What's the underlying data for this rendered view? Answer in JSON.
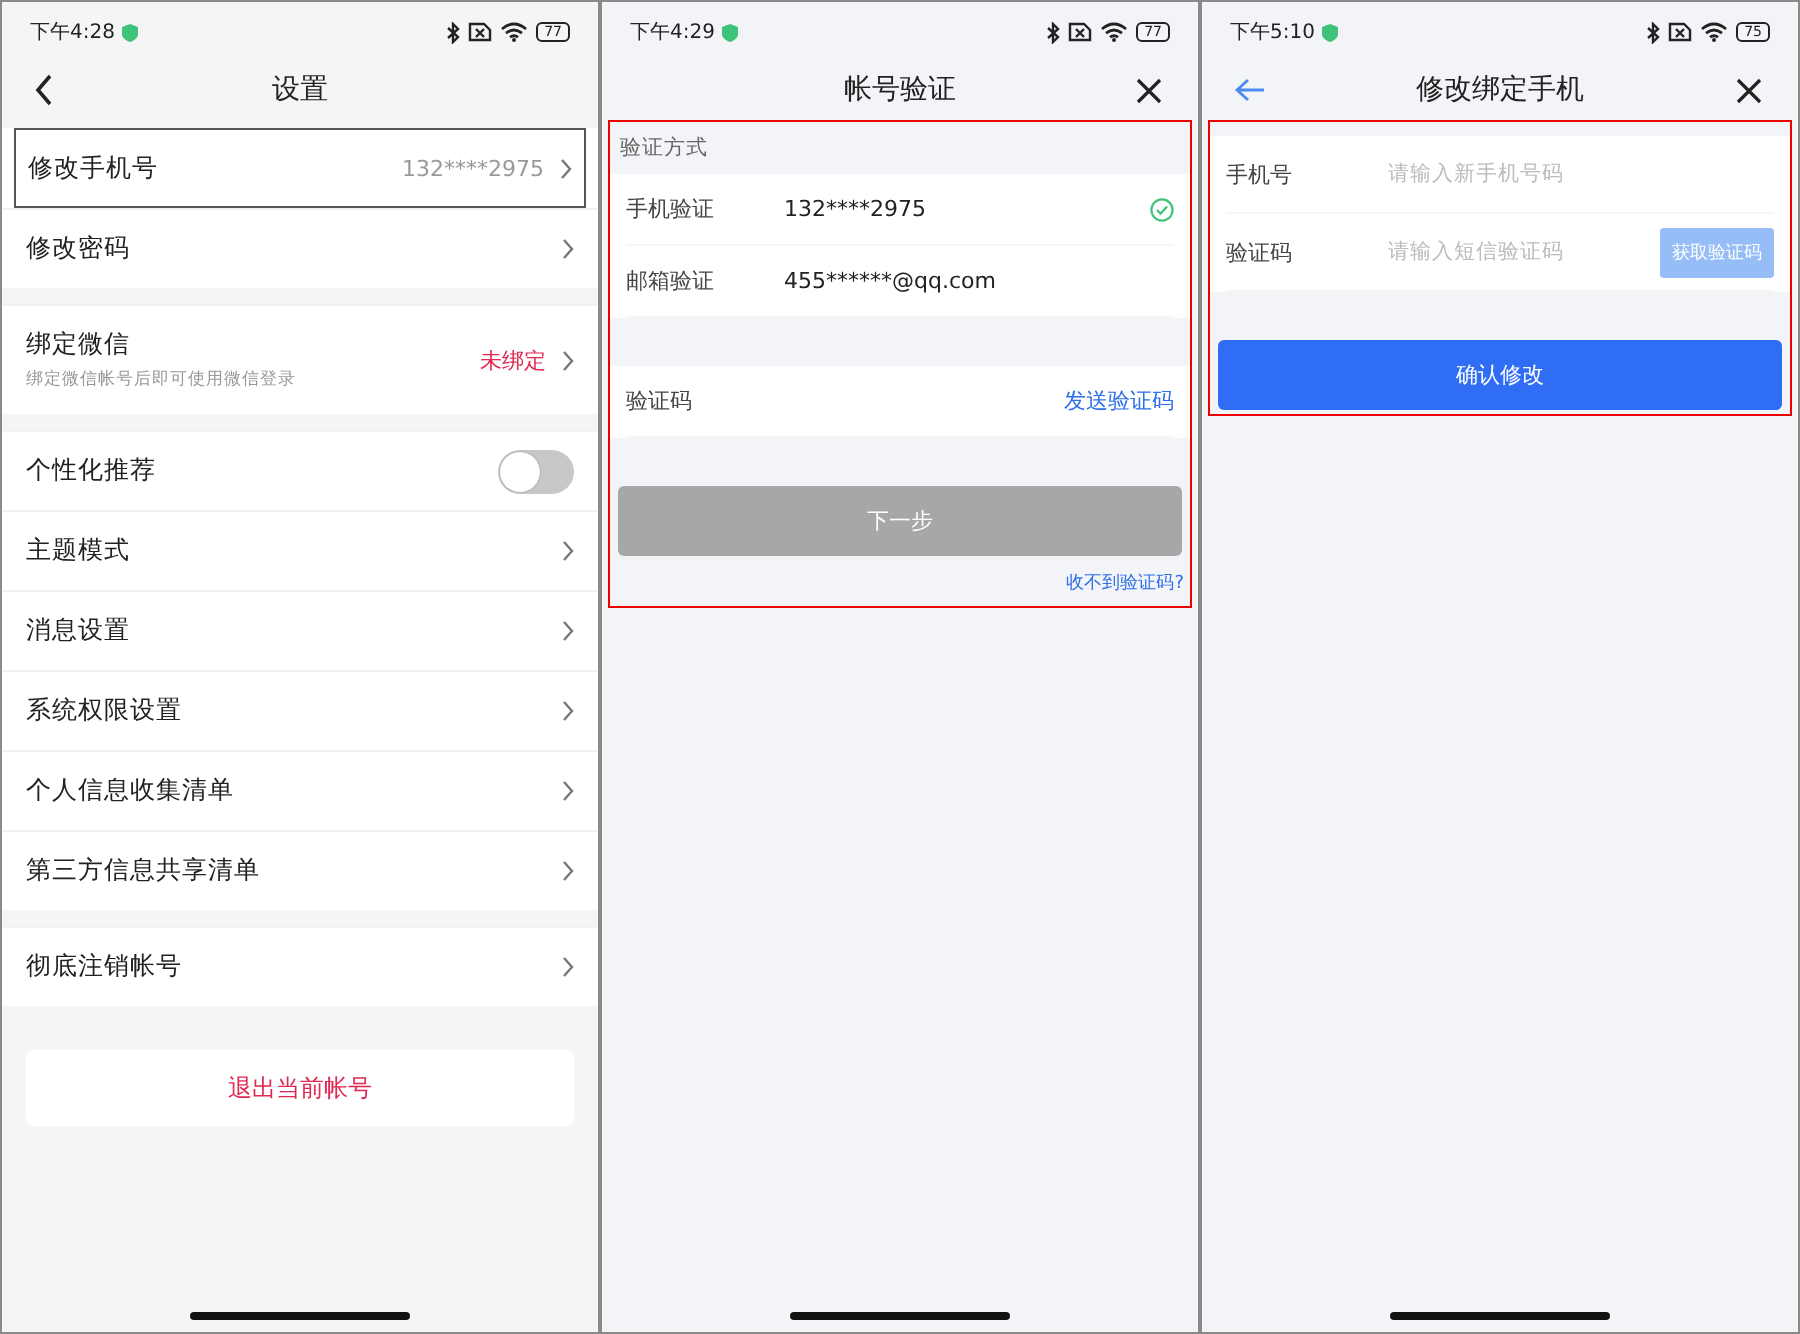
{
  "screens": [
    {
      "kind": "settings",
      "status_bar": {
        "time": "下午4:28",
        "battery": "77"
      },
      "header": {
        "title": "设置",
        "back_chevron": true,
        "back_arrow": false,
        "close": false
      },
      "groups": [
        {
          "items": [
            {
              "kind": "link",
              "label": "修改手机号",
              "value": "132****2975",
              "alert": false,
              "highlighted": true
            },
            {
              "kind": "link",
              "label": "修改密码",
              "highlighted": false
            }
          ]
        },
        {
          "items": [
            {
              "kind": "link",
              "label": "绑定微信",
              "subtitle": "绑定微信帐号后即可使用微信登录",
              "value": "未绑定",
              "alert": true,
              "highlighted": false
            }
          ]
        },
        {
          "items": [
            {
              "kind": "toggle",
              "label": "个性化推荐",
              "on": false,
              "highlighted": false
            },
            {
              "kind": "link",
              "label": "主题模式",
              "highlighted": false
            },
            {
              "kind": "link",
              "label": "消息设置",
              "highlighted": false
            },
            {
              "kind": "link",
              "label": "系统权限设置",
              "highlighted": false
            },
            {
              "kind": "link",
              "label": "个人信息收集清单",
              "highlighted": false
            },
            {
              "kind": "link",
              "label": "第三方信息共享清单",
              "highlighted": false
            }
          ]
        },
        {
          "items": [
            {
              "kind": "link",
              "label": "彻底注销帐号",
              "highlighted": false
            }
          ]
        }
      ],
      "logout_button": "退出当前帐号"
    },
    {
      "kind": "verify",
      "status_bar": {
        "time": "下午4:29",
        "battery": "77"
      },
      "header": {
        "title": "帐号验证",
        "back_chevron": false,
        "back_arrow": false,
        "close": true
      },
      "highlighted": true,
      "section_label": "验证方式",
      "methods": [
        {
          "label": "手机验证",
          "value": "132****2975",
          "selected": true
        },
        {
          "label": "邮箱验证",
          "value": "455******@qq.com",
          "selected": false
        }
      ],
      "code_row": {
        "label": "验证码",
        "action": "发送验证码"
      },
      "next_button": {
        "label": "下一步",
        "disabled": true
      },
      "help_link": "收不到验证码?"
    },
    {
      "kind": "rebind",
      "status_bar": {
        "time": "下午5:10",
        "battery": "75"
      },
      "header": {
        "title": "修改绑定手机",
        "back_chevron": false,
        "back_arrow": true,
        "close": true
      },
      "highlighted": true,
      "fields": [
        {
          "label": "手机号",
          "placeholder": "请输入新手机号码"
        },
        {
          "label": "验证码",
          "placeholder": "请输入短信验证码",
          "button": {
            "label": "获取验证码",
            "disabled": true
          }
        }
      ],
      "confirm_button": {
        "label": "确认修改",
        "disabled": false
      }
    }
  ]
}
